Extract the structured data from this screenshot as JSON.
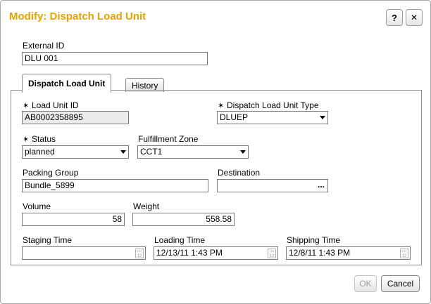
{
  "dialog": {
    "title": "Modify: Dispatch Load Unit",
    "help_label": "?",
    "close_label": "✕"
  },
  "external_id": {
    "label": "External ID",
    "value": "DLU 001"
  },
  "tabs": [
    {
      "label": "Dispatch Load Unit",
      "active": true
    },
    {
      "label": "History",
      "active": false
    }
  ],
  "required_marker": "✶",
  "fields": {
    "load_unit_id": {
      "label": "Load Unit ID",
      "value": "AB0002358895"
    },
    "dlu_type": {
      "label": "Dispatch Load Unit Type",
      "value": "DLUEP"
    },
    "status": {
      "label": "Status",
      "value": "planned"
    },
    "fulfillment_zone": {
      "label": "Fulfillment Zone",
      "value": "CCT1"
    },
    "packing_group": {
      "label": "Packing Group",
      "value": "Bundle_5899"
    },
    "destination": {
      "label": "Destination",
      "value": "",
      "button": "..."
    },
    "volume": {
      "label": "Volume",
      "value": "58"
    },
    "weight": {
      "label": "Weight",
      "value": "558.58"
    },
    "staging_time": {
      "label": "Staging Time",
      "value": ""
    },
    "loading_time": {
      "label": "Loading Time",
      "value": "12/13/11 1:43 PM"
    },
    "shipping_time": {
      "label": "Shipping Time",
      "value": "12/8/11 1:43 PM"
    }
  },
  "buttons": {
    "ok": "OK",
    "cancel": "Cancel"
  },
  "colors": {
    "title": "#e8a200",
    "readonly_bg": "#ececec"
  }
}
